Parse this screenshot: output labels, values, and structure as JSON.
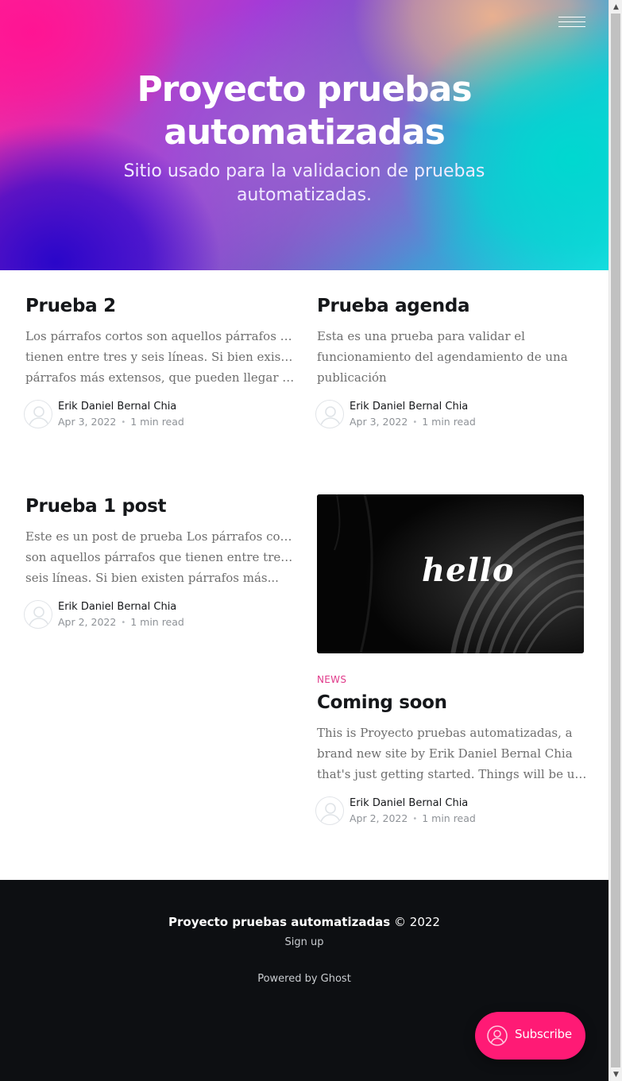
{
  "site": {
    "title": "Proyecto pruebas automatizadas",
    "description": "Sitio usado para la validacion de pruebas automatizadas."
  },
  "posts": [
    {
      "title": "Prueba 2",
      "excerpt_lines": [
        "Los párrafos cortos son aquellos párrafos que",
        "tienen entre tres y seis líneas. Si bien existen",
        "párrafos más extensos, que pueden llegar has..."
      ],
      "author": "Erik Daniel Bernal Chia",
      "date": "Apr 3, 2022",
      "read_time": "1 min read"
    },
    {
      "title": "Prueba agenda",
      "excerpt_lines": [
        "Esta es una prueba para validar el",
        "funcionamiento del agendamiento de una",
        "publicación"
      ],
      "author": "Erik Daniel Bernal Chia",
      "date": "Apr 3, 2022",
      "read_time": "1 min read"
    },
    {
      "title": "Prueba 1 post",
      "excerpt_lines": [
        "Este es un post de prueba Los párrafos cortos",
        "son aquellos párrafos que tienen entre tres y",
        "seis líneas. Si bien existen párrafos más..."
      ],
      "author": "Erik Daniel Bernal Chia",
      "date": "Apr 2, 2022",
      "read_time": "1 min read"
    },
    {
      "tag": "NEWS",
      "image_text": "hello",
      "title": "Coming soon",
      "excerpt_lines": [
        "This is Proyecto pruebas automatizadas, a",
        "brand new site by Erik Daniel Bernal Chia",
        "that's just getting started. Things will be up a..."
      ],
      "author": "Erik Daniel Bernal Chia",
      "date": "Apr 2, 2022",
      "read_time": "1 min read"
    }
  ],
  "footer": {
    "site_name": "Proyecto pruebas automatizadas",
    "copyright": "© 2022",
    "signup": "Sign up",
    "powered_by": "Powered by Ghost"
  },
  "subscribe": {
    "label": "Subscribe",
    "icon": "user-circle-icon"
  },
  "icons": {
    "menu": "hamburger-menu-icon",
    "avatar": "default-avatar-icon"
  },
  "colors": {
    "accent": "#ff1a75",
    "tag": "#e03a8a",
    "footer_bg": "#0d0f12"
  }
}
